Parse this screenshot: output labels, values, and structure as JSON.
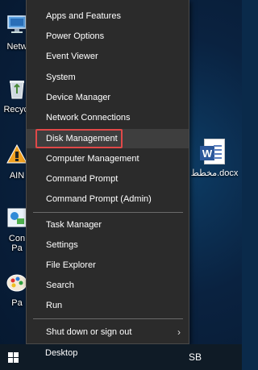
{
  "desktop": {
    "icons": [
      {
        "label": "Netw",
        "icon": "network-icon"
      },
      {
        "label": "Recycl",
        "icon": "recycle-bin-icon"
      },
      {
        "label": "AIN",
        "icon": "app-shortcut-icon"
      },
      {
        "label": "Con",
        "label2": "Pa",
        "icon": "control-panel-icon"
      },
      {
        "label": "Pa",
        "icon": "paint-icon"
      }
    ],
    "file": {
      "label": "مخطط.docx",
      "icon": "word-document-icon"
    }
  },
  "menu": {
    "items": [
      {
        "label": "Apps and Features"
      },
      {
        "label": "Power Options"
      },
      {
        "label": "Event Viewer"
      },
      {
        "label": "System"
      },
      {
        "label": "Device Manager"
      },
      {
        "label": "Network Connections"
      },
      {
        "label": "Disk Management"
      },
      {
        "label": "Computer Management"
      },
      {
        "label": "Command Prompt"
      },
      {
        "label": "Command Prompt (Admin)"
      },
      {
        "label": "Task Manager"
      },
      {
        "label": "Settings"
      },
      {
        "label": "File Explorer"
      },
      {
        "label": "Search"
      },
      {
        "label": "Run"
      },
      {
        "label": "Shut down or sign out",
        "submenu_glyph": "›"
      },
      {
        "label": "Desktop"
      }
    ],
    "highlighted": "Disk Management"
  },
  "taskbar": {
    "text": "SB",
    "start_icon": "windows-logo-icon"
  },
  "colors": {
    "menu_bg": "#2b2b2b",
    "hover_bg": "#3e3e3e",
    "highlight_border": "#e04848",
    "taskbar_bg": "#0f1b26"
  }
}
